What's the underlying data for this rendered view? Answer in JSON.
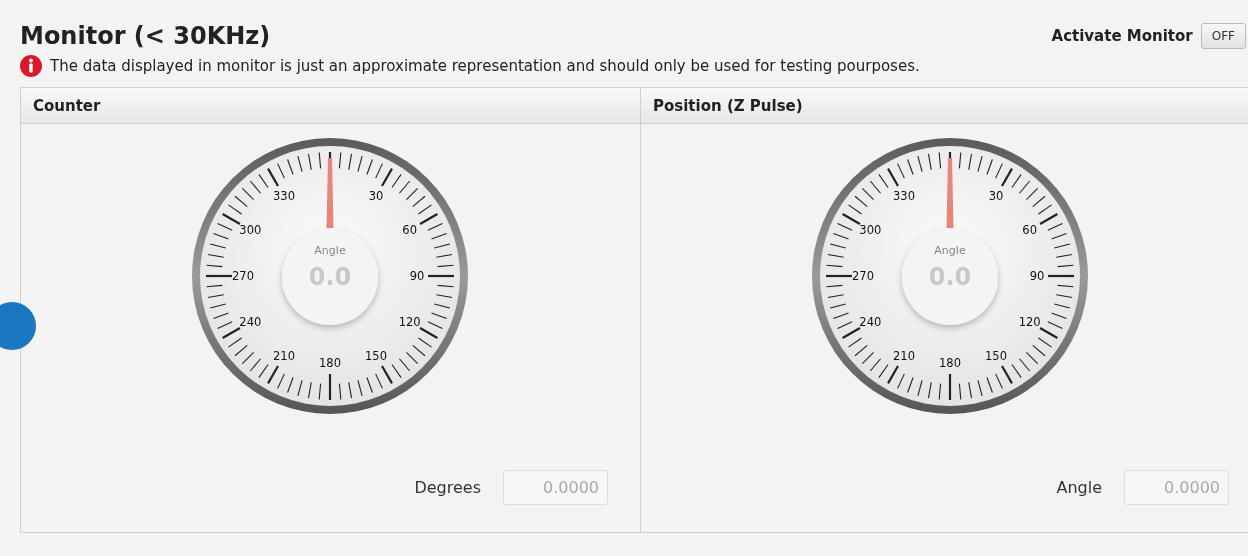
{
  "title": "Monitor (< 30KHz)",
  "activate_monitor": {
    "label": "Activate Monitor",
    "on": false,
    "text": "OFF"
  },
  "notice": "The data displayed in monitor is just an approximate representation and should only be used for testing pourposes.",
  "callout": {
    "kind": "marker"
  },
  "panels": [
    {
      "title": "Counter",
      "gauge": {
        "caption": "Angle",
        "value": "0.0",
        "scale_labels": [
          "30",
          "60",
          "90",
          "120",
          "150",
          "180",
          "210",
          "240",
          "270",
          "300",
          "330"
        ]
      },
      "field": {
        "label": "Degrees",
        "value": "0.0000"
      }
    },
    {
      "title": "Position (Z Pulse)",
      "gauge": {
        "caption": "Angle",
        "value": "0.0",
        "scale_labels": [
          "30",
          "60",
          "90",
          "120",
          "150",
          "180",
          "210",
          "240",
          "270",
          "300",
          "330"
        ]
      },
      "field": {
        "label": "Angle",
        "value": "0.0000"
      }
    }
  ]
}
